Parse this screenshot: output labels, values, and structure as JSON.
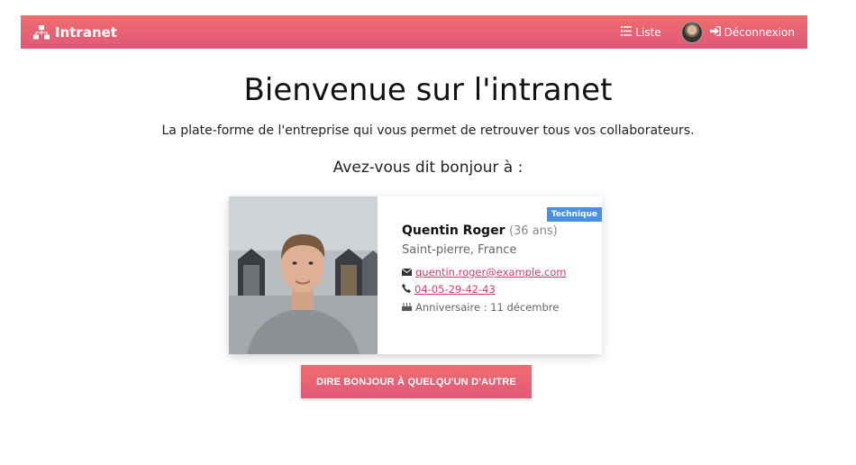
{
  "navbar": {
    "brand": "Intranet",
    "list_label": "Liste",
    "logout_label": "Déconnexion",
    "color": "#e8617a"
  },
  "hero": {
    "title": "Bienvenue sur l'intranet",
    "subtitle": "La plate-forme de l'entreprise qui vous permet de retrouver tous vos collaborateurs.",
    "question": "Avez-vous dit bonjour à :"
  },
  "card": {
    "tag": "Technique",
    "name": "Quentin Roger",
    "age": "(36 ans)",
    "location": "Saint-pierre, France",
    "email": "quentin.roger@example.com",
    "phone": "04-05-29-42-43",
    "birthday": "Anniversaire : 11 décembre"
  },
  "button": {
    "label": "DIRE BONJOUR À QUELQU'UN D'AUTRE"
  },
  "icons": {
    "brand": "sitemap-icon",
    "list": "list-icon",
    "logout": "sign-out-icon",
    "email": "envelope-icon",
    "phone": "phone-icon",
    "birthday": "birthday-cake-icon"
  }
}
